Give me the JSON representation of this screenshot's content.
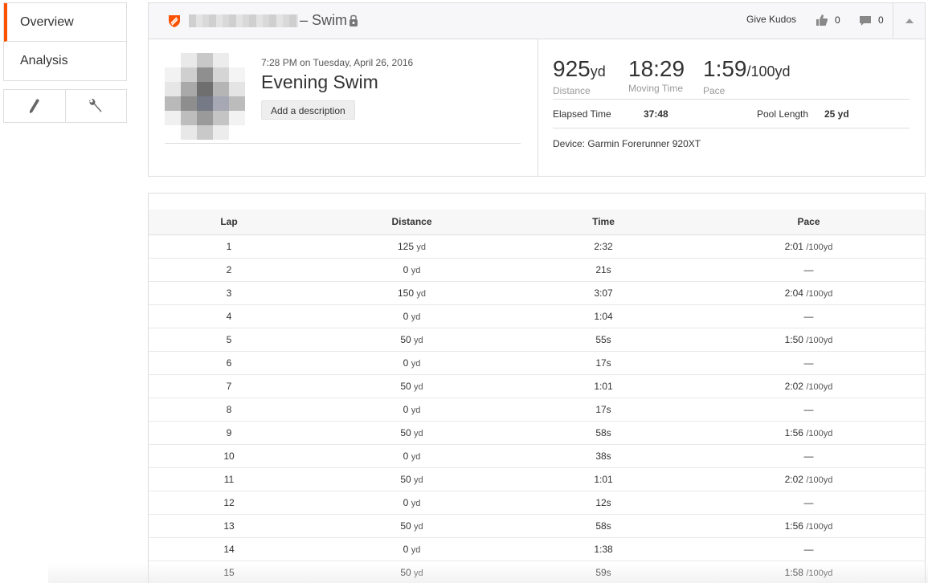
{
  "sidebar": {
    "nav": [
      {
        "label": "Overview",
        "active": true
      },
      {
        "label": "Analysis",
        "active": false
      }
    ],
    "tools": [
      "pencil-icon",
      "wrench-icon"
    ]
  },
  "header": {
    "sport_label": "– Swim",
    "kudos_label": "Give Kudos",
    "kudos_count": "0",
    "comments_count": "0",
    "brand_color": "#fc5200"
  },
  "activity": {
    "datetime": "7:28 PM on Tuesday, April 26, 2016",
    "title": "Evening Swim",
    "add_description": "Add a description"
  },
  "stats": {
    "distance": {
      "value": "925",
      "unit": "yd",
      "label": "Distance"
    },
    "moving_time": {
      "value": "18:29",
      "label": "Moving Time"
    },
    "pace": {
      "value": "1:59",
      "unit": "/100yd",
      "label": "Pace"
    },
    "elapsed_label": "Elapsed Time",
    "elapsed_value": "37:48",
    "pool_label": "Pool Length",
    "pool_value": "25 yd",
    "device": "Device: Garmin Forerunner 920XT"
  },
  "laps": {
    "headers": [
      "Lap",
      "Distance",
      "Time",
      "Pace"
    ],
    "rows": [
      {
        "lap": "1",
        "dist": "125",
        "unit": "yd",
        "time": "2:32",
        "pace": "2:01",
        "pace_unit": "/100yd"
      },
      {
        "lap": "2",
        "dist": "0",
        "unit": "yd",
        "time": "21s",
        "pace": "—",
        "pace_unit": ""
      },
      {
        "lap": "3",
        "dist": "150",
        "unit": "yd",
        "time": "3:07",
        "pace": "2:04",
        "pace_unit": "/100yd"
      },
      {
        "lap": "4",
        "dist": "0",
        "unit": "yd",
        "time": "1:04",
        "pace": "—",
        "pace_unit": ""
      },
      {
        "lap": "5",
        "dist": "50",
        "unit": "yd",
        "time": "55s",
        "pace": "1:50",
        "pace_unit": "/100yd"
      },
      {
        "lap": "6",
        "dist": "0",
        "unit": "yd",
        "time": "17s",
        "pace": "—",
        "pace_unit": ""
      },
      {
        "lap": "7",
        "dist": "50",
        "unit": "yd",
        "time": "1:01",
        "pace": "2:02",
        "pace_unit": "/100yd"
      },
      {
        "lap": "8",
        "dist": "0",
        "unit": "yd",
        "time": "17s",
        "pace": "—",
        "pace_unit": ""
      },
      {
        "lap": "9",
        "dist": "50",
        "unit": "yd",
        "time": "58s",
        "pace": "1:56",
        "pace_unit": "/100yd"
      },
      {
        "lap": "10",
        "dist": "0",
        "unit": "yd",
        "time": "38s",
        "pace": "—",
        "pace_unit": ""
      },
      {
        "lap": "11",
        "dist": "50",
        "unit": "yd",
        "time": "1:01",
        "pace": "2:02",
        "pace_unit": "/100yd"
      },
      {
        "lap": "12",
        "dist": "0",
        "unit": "yd",
        "time": "12s",
        "pace": "—",
        "pace_unit": ""
      },
      {
        "lap": "13",
        "dist": "50",
        "unit": "yd",
        "time": "58s",
        "pace": "1:56",
        "pace_unit": "/100yd"
      },
      {
        "lap": "14",
        "dist": "0",
        "unit": "yd",
        "time": "1:38",
        "pace": "—",
        "pace_unit": ""
      },
      {
        "lap": "15",
        "dist": "50",
        "unit": "yd",
        "time": "59s",
        "pace": "1:58",
        "pace_unit": "/100yd"
      }
    ]
  }
}
